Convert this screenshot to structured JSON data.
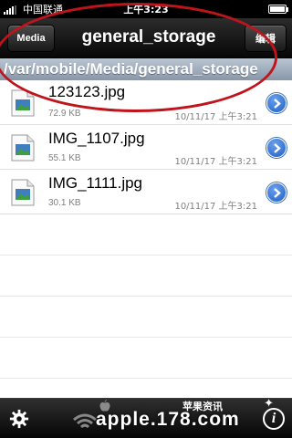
{
  "status_bar": {
    "carrier": "中国联通",
    "time": "上午3:23"
  },
  "nav": {
    "back_label": "Media",
    "title": "general_storage",
    "right_label": "编辑"
  },
  "path": "/var/mobile/Media/general_storage",
  "files": [
    {
      "name": "123123.jpg",
      "size": "72.9 KB",
      "date": "10/11/17 上午3:21"
    },
    {
      "name": "IMG_1107.jpg",
      "size": "55.1 KB",
      "date": "10/11/17 上午3:21"
    },
    {
      "name": "IMG_1111.jpg",
      "size": "30.1 KB",
      "date": "10/11/17 上午3:21"
    }
  ],
  "watermark": {
    "site": "apple.178.com",
    "cn": "苹果资讯"
  },
  "icons": [
    "settings-icon",
    "wifi-icon",
    "apple-icon",
    "info-icon",
    "image-file-icon",
    "disclosure-icon"
  ],
  "colors": {
    "annotation": "#c0141d",
    "path_bar": "#9aa8b8",
    "disclosure": "#2a6fd6"
  }
}
